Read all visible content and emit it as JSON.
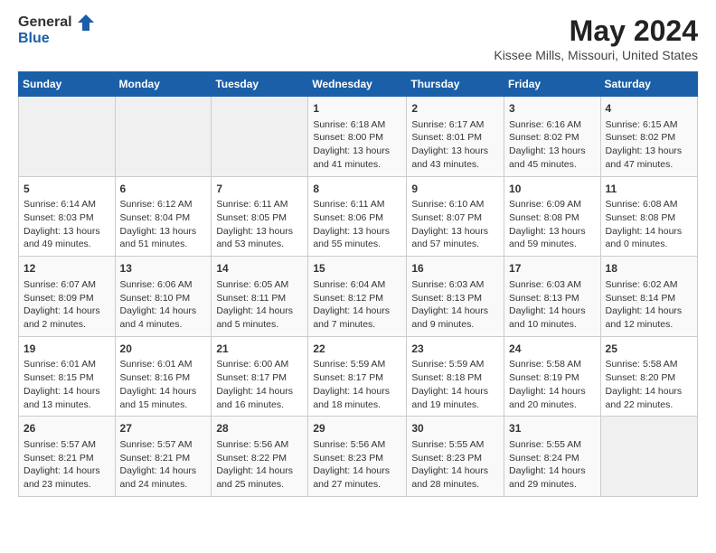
{
  "logo": {
    "general": "General",
    "blue": "Blue"
  },
  "title": "May 2024",
  "subtitle": "Kissee Mills, Missouri, United States",
  "days_of_week": [
    "Sunday",
    "Monday",
    "Tuesday",
    "Wednesday",
    "Thursday",
    "Friday",
    "Saturday"
  ],
  "weeks": [
    [
      {
        "day": "",
        "info": ""
      },
      {
        "day": "",
        "info": ""
      },
      {
        "day": "",
        "info": ""
      },
      {
        "day": "1",
        "info": "Sunrise: 6:18 AM\nSunset: 8:00 PM\nDaylight: 13 hours\nand 41 minutes."
      },
      {
        "day": "2",
        "info": "Sunrise: 6:17 AM\nSunset: 8:01 PM\nDaylight: 13 hours\nand 43 minutes."
      },
      {
        "day": "3",
        "info": "Sunrise: 6:16 AM\nSunset: 8:02 PM\nDaylight: 13 hours\nand 45 minutes."
      },
      {
        "day": "4",
        "info": "Sunrise: 6:15 AM\nSunset: 8:02 PM\nDaylight: 13 hours\nand 47 minutes."
      }
    ],
    [
      {
        "day": "5",
        "info": "Sunrise: 6:14 AM\nSunset: 8:03 PM\nDaylight: 13 hours\nand 49 minutes."
      },
      {
        "day": "6",
        "info": "Sunrise: 6:12 AM\nSunset: 8:04 PM\nDaylight: 13 hours\nand 51 minutes."
      },
      {
        "day": "7",
        "info": "Sunrise: 6:11 AM\nSunset: 8:05 PM\nDaylight: 13 hours\nand 53 minutes."
      },
      {
        "day": "8",
        "info": "Sunrise: 6:11 AM\nSunset: 8:06 PM\nDaylight: 13 hours\nand 55 minutes."
      },
      {
        "day": "9",
        "info": "Sunrise: 6:10 AM\nSunset: 8:07 PM\nDaylight: 13 hours\nand 57 minutes."
      },
      {
        "day": "10",
        "info": "Sunrise: 6:09 AM\nSunset: 8:08 PM\nDaylight: 13 hours\nand 59 minutes."
      },
      {
        "day": "11",
        "info": "Sunrise: 6:08 AM\nSunset: 8:08 PM\nDaylight: 14 hours\nand 0 minutes."
      }
    ],
    [
      {
        "day": "12",
        "info": "Sunrise: 6:07 AM\nSunset: 8:09 PM\nDaylight: 14 hours\nand 2 minutes."
      },
      {
        "day": "13",
        "info": "Sunrise: 6:06 AM\nSunset: 8:10 PM\nDaylight: 14 hours\nand 4 minutes."
      },
      {
        "day": "14",
        "info": "Sunrise: 6:05 AM\nSunset: 8:11 PM\nDaylight: 14 hours\nand 5 minutes."
      },
      {
        "day": "15",
        "info": "Sunrise: 6:04 AM\nSunset: 8:12 PM\nDaylight: 14 hours\nand 7 minutes."
      },
      {
        "day": "16",
        "info": "Sunrise: 6:03 AM\nSunset: 8:13 PM\nDaylight: 14 hours\nand 9 minutes."
      },
      {
        "day": "17",
        "info": "Sunrise: 6:03 AM\nSunset: 8:13 PM\nDaylight: 14 hours\nand 10 minutes."
      },
      {
        "day": "18",
        "info": "Sunrise: 6:02 AM\nSunset: 8:14 PM\nDaylight: 14 hours\nand 12 minutes."
      }
    ],
    [
      {
        "day": "19",
        "info": "Sunrise: 6:01 AM\nSunset: 8:15 PM\nDaylight: 14 hours\nand 13 minutes."
      },
      {
        "day": "20",
        "info": "Sunrise: 6:01 AM\nSunset: 8:16 PM\nDaylight: 14 hours\nand 15 minutes."
      },
      {
        "day": "21",
        "info": "Sunrise: 6:00 AM\nSunset: 8:17 PM\nDaylight: 14 hours\nand 16 minutes."
      },
      {
        "day": "22",
        "info": "Sunrise: 5:59 AM\nSunset: 8:17 PM\nDaylight: 14 hours\nand 18 minutes."
      },
      {
        "day": "23",
        "info": "Sunrise: 5:59 AM\nSunset: 8:18 PM\nDaylight: 14 hours\nand 19 minutes."
      },
      {
        "day": "24",
        "info": "Sunrise: 5:58 AM\nSunset: 8:19 PM\nDaylight: 14 hours\nand 20 minutes."
      },
      {
        "day": "25",
        "info": "Sunrise: 5:58 AM\nSunset: 8:20 PM\nDaylight: 14 hours\nand 22 minutes."
      }
    ],
    [
      {
        "day": "26",
        "info": "Sunrise: 5:57 AM\nSunset: 8:21 PM\nDaylight: 14 hours\nand 23 minutes."
      },
      {
        "day": "27",
        "info": "Sunrise: 5:57 AM\nSunset: 8:21 PM\nDaylight: 14 hours\nand 24 minutes."
      },
      {
        "day": "28",
        "info": "Sunrise: 5:56 AM\nSunset: 8:22 PM\nDaylight: 14 hours\nand 25 minutes."
      },
      {
        "day": "29",
        "info": "Sunrise: 5:56 AM\nSunset: 8:23 PM\nDaylight: 14 hours\nand 27 minutes."
      },
      {
        "day": "30",
        "info": "Sunrise: 5:55 AM\nSunset: 8:23 PM\nDaylight: 14 hours\nand 28 minutes."
      },
      {
        "day": "31",
        "info": "Sunrise: 5:55 AM\nSunset: 8:24 PM\nDaylight: 14 hours\nand 29 minutes."
      },
      {
        "day": "",
        "info": ""
      }
    ]
  ]
}
